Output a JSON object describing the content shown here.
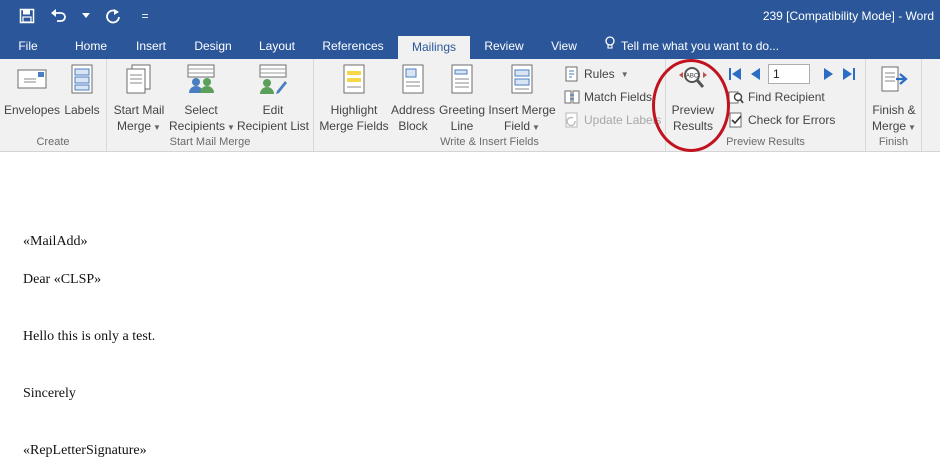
{
  "title_bar": {
    "document_title": "239 [Compatibility Mode] - Word",
    "qat": {
      "save_icon": "save-icon",
      "undo_icon": "undo-icon",
      "redo_icon": "redo-icon",
      "customize_label": "="
    }
  },
  "tabs": [
    {
      "label": "File"
    },
    {
      "label": "Home"
    },
    {
      "label": "Insert"
    },
    {
      "label": "Design"
    },
    {
      "label": "Layout"
    },
    {
      "label": "References"
    },
    {
      "label": "Mailings",
      "active": true
    },
    {
      "label": "Review"
    },
    {
      "label": "View"
    }
  ],
  "tell_me": {
    "label": "Tell me what you want to do..."
  },
  "ribbon": {
    "create": {
      "label": "Create",
      "envelopes": "Envelopes",
      "labels": "Labels"
    },
    "start_mail_merge": {
      "label": "Start Mail Merge",
      "start_mail_merge_l1": "Start Mail",
      "start_mail_merge_l2": "Merge",
      "select_recipients_l1": "Select",
      "select_recipients_l2": "Recipients",
      "edit_recipient_l1": "Edit",
      "edit_recipient_l2": "Recipient List"
    },
    "write_insert": {
      "label": "Write & Insert Fields",
      "highlight_l1": "Highlight",
      "highlight_l2": "Merge Fields",
      "address_l1": "Address",
      "address_l2": "Block",
      "greeting_l1": "Greeting",
      "greeting_l2": "Line",
      "insert_field_l1": "Insert Merge",
      "insert_field_l2": "Field",
      "rules": "Rules",
      "match_fields": "Match Fields",
      "update_labels": "Update Labels"
    },
    "preview": {
      "label": "Preview Results",
      "preview_l1": "Preview",
      "preview_l2": "Results",
      "record_value": "1",
      "find_recipient": "Find Recipient",
      "check_errors": "Check for Errors"
    },
    "finish": {
      "label": "Finish",
      "finish_l1": "Finish &",
      "finish_l2": "Merge"
    }
  },
  "document": {
    "lines": [
      "«MailAdd»",
      "Dear «CLSP»",
      "Hello this is only a test.",
      "Sincerely",
      "«RepLetterSignature»"
    ]
  },
  "colors": {
    "accent": "#2b579a",
    "ribbon_bg": "#f1f1f1",
    "highlight": "#c1121f"
  }
}
